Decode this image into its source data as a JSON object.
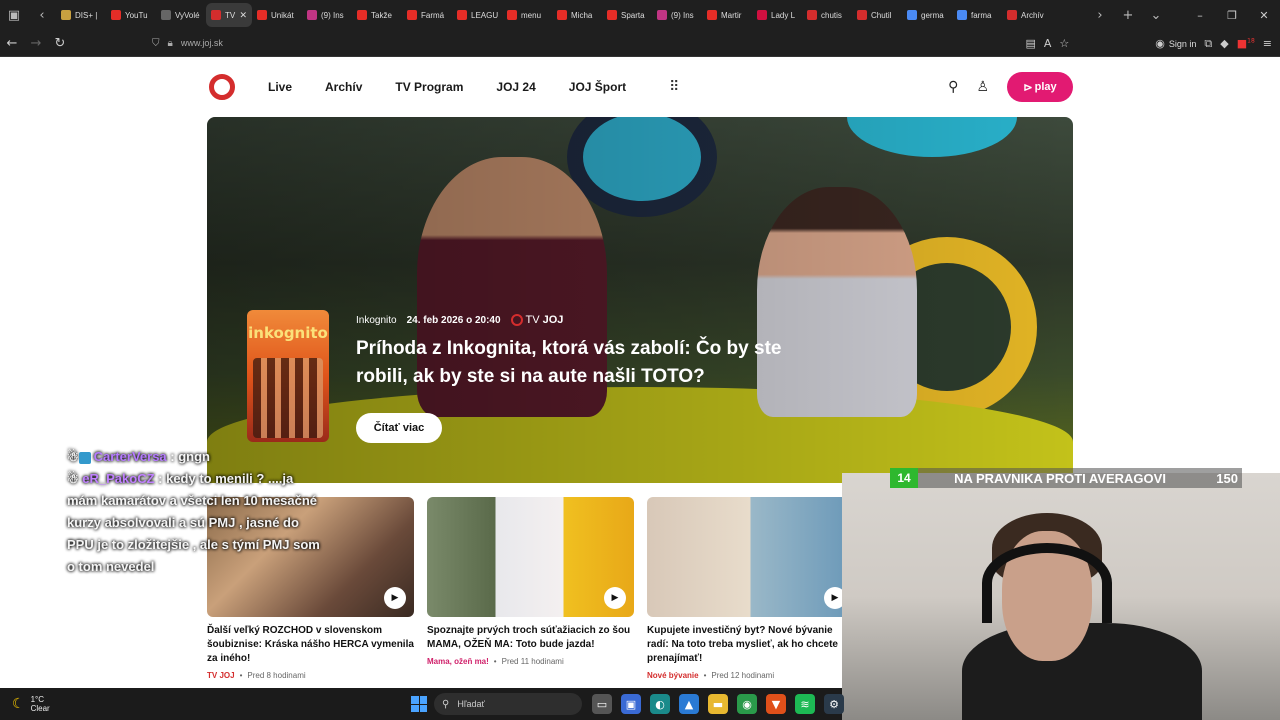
{
  "browser": {
    "tabs": [
      {
        "label": "DIS+ |",
        "color": "#c8a040"
      },
      {
        "label": "YouTu",
        "color": "#e52d27"
      },
      {
        "label": "VyVolé",
        "color": "#666666"
      },
      {
        "label": "TV",
        "color": "#d42d2d",
        "active": true
      },
      {
        "label": "Unikát",
        "color": "#e52d27"
      },
      {
        "label": "(9) Ins",
        "color": "#c13584"
      },
      {
        "label": "Takže",
        "color": "#e52d27"
      },
      {
        "label": "Farmá",
        "color": "#e52d27"
      },
      {
        "label": "LEAGU",
        "color": "#e52d27"
      },
      {
        "label": "menu",
        "color": "#e52d27"
      },
      {
        "label": "Micha",
        "color": "#e52d27"
      },
      {
        "label": "Sparta",
        "color": "#e52d27"
      },
      {
        "label": "(9) Ins",
        "color": "#c13584"
      },
      {
        "label": "Martir",
        "color": "#e52d27"
      },
      {
        "label": "Lady L",
        "color": "#d01040"
      },
      {
        "label": "chutis",
        "color": "#d42d2d"
      },
      {
        "label": "Chutil",
        "color": "#d42d2d"
      },
      {
        "label": "germa",
        "color": "#4a8af4"
      },
      {
        "label": "farma",
        "color": "#4a8af4"
      },
      {
        "label": "Archív",
        "color": "#d42d2d"
      }
    ],
    "tab_close": "✕",
    "url": "www.joj.sk",
    "sign_in": "Sign in",
    "badge_count": "18"
  },
  "site": {
    "nav": [
      "Live",
      "Archív",
      "TV Program",
      "JOJ 24",
      "JOJ Šport"
    ],
    "play_label": "play"
  },
  "hero": {
    "show": "Inkognito",
    "date": "24. feb 2026 o 20:40",
    "channel_tv": "TV",
    "channel_joj": "JOJ",
    "title": "Príhoda z Inkognita, ktorá vás zabolí: Čo by ste robili, ak by ste si na aute našli TOTO?",
    "read_more": "Čítať viac",
    "poster_title": "inkognito"
  },
  "cards": [
    {
      "title": "Ďalší veľký ROZCHOD v slovenskom šoubiznise: Kráska nášho HERCA vymenila za iného!",
      "category": "TV JOJ",
      "time": "Pred 8 hodinami",
      "cat_color": "#d42d2d"
    },
    {
      "title": "Spoznajte prvých troch súťažiacich zo šou MAMA, OŽEŇ MA: Toto bude jazda!",
      "category": "Mama, ožeň ma!",
      "time": "Pred 11 hodinami",
      "cat_color": "#d0206a"
    },
    {
      "title": "Kupujete investičný byt? Nové bývanie radí: Na toto treba myslieť, ak ho chcete prenajímať!",
      "category": "Nové bývanie",
      "time": "Pred 12 hodinami",
      "cat_color": "#d42d2d"
    }
  ],
  "chat": [
    {
      "user": "CarterVersa",
      "message": ": gngn"
    },
    {
      "user": "eR_PakoCZ",
      "message": ": kedy to menili ? ....ja mám kamarátov a všetci len 10 mesačné kurzy absolvovali a sú PMJ , jasné do PPU je to zložitejšie , ale s týmí PMJ som o tom nevedel"
    }
  ],
  "stream_overlay": {
    "left_score": "14",
    "caption": "NA PRAVNIKA PROTI AVERAGOVI",
    "right_score": "150"
  },
  "taskbar": {
    "temp": "1°C",
    "condition": "Clear",
    "search_placeholder": "Hľadať"
  }
}
